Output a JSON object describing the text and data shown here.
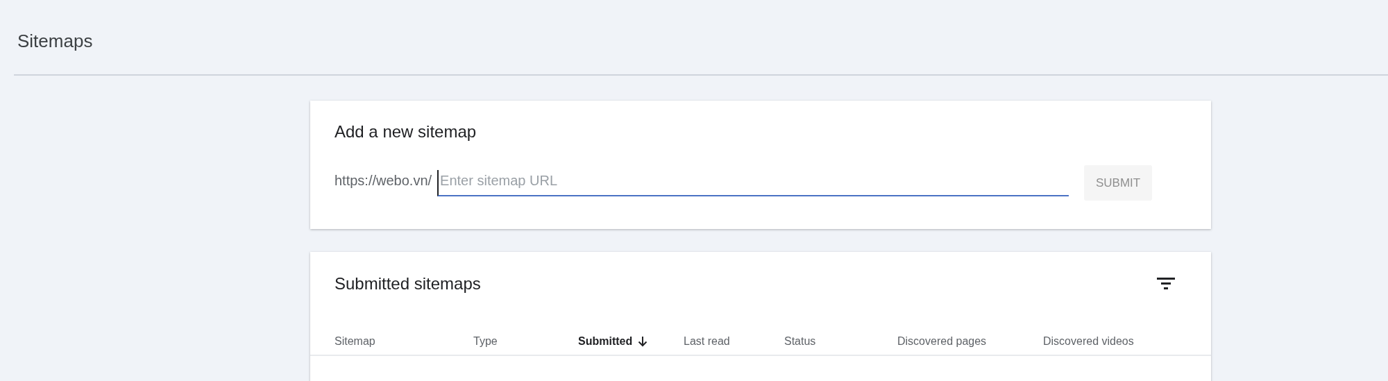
{
  "page": {
    "title": "Sitemaps"
  },
  "add_card": {
    "title": "Add a new sitemap",
    "prefix": "https://webo.vn/",
    "placeholder": "Enter sitemap URL",
    "submit": {
      "label": "SUBMIT",
      "disabled": true
    }
  },
  "submitted_card": {
    "title": "Submitted sitemaps",
    "columns": [
      {
        "label": "Sitemap",
        "sorted": false
      },
      {
        "label": "Type",
        "sorted": false
      },
      {
        "label": "Submitted",
        "sorted": true
      },
      {
        "label": "Last read",
        "sorted": false
      },
      {
        "label": "Status",
        "sorted": false
      },
      {
        "label": "Discovered pages",
        "sorted": false
      },
      {
        "label": "Discovered videos",
        "sorted": false
      }
    ]
  }
}
